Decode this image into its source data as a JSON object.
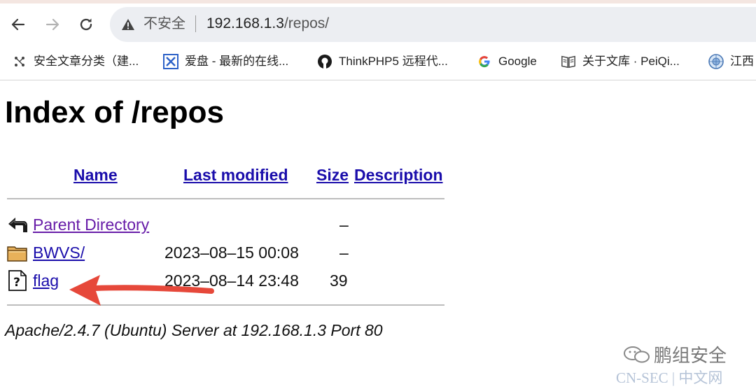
{
  "browser": {
    "security_label": "不安全",
    "url_host": "192.168.1.3",
    "url_path": "/repos/"
  },
  "bookmarks": [
    {
      "label": "安全文章分类（建...",
      "icon": "network-icon"
    },
    {
      "label": "爱盘 - 最新的在线...",
      "icon": "aipan-icon"
    },
    {
      "label": "ThinkPHP5 远程代...",
      "icon": "github-icon"
    },
    {
      "label": "Google",
      "icon": "google-icon"
    },
    {
      "label": "关于文库 · PeiQi...",
      "icon": "book-icon"
    },
    {
      "label": "江西",
      "icon": "globe-icon"
    }
  ],
  "page": {
    "title": "Index of /repos",
    "columns": {
      "name": "Name",
      "last_modified": "Last modified",
      "size": "Size",
      "description": "Description"
    },
    "rows": [
      {
        "name": "Parent Directory",
        "modified": "",
        "size": "–",
        "icon": "back-arrow-icon"
      },
      {
        "name": "BWVS/",
        "modified": "2023–08–15 00:08",
        "size": "–",
        "icon": "folder-icon"
      },
      {
        "name": "flag",
        "modified": "2023–08–14 23:48",
        "size": "39",
        "icon": "unknown-file-icon"
      }
    ],
    "footer": "Apache/2.4.7 (Ubuntu) Server at 192.168.1.3 Port 80"
  },
  "watermark": {
    "account": "鹏组安全",
    "site": "CN-SEC | 中文网"
  },
  "colors": {
    "link": "#1a0dab",
    "visited_link": "#681da8",
    "arrow": "#e6483a"
  }
}
